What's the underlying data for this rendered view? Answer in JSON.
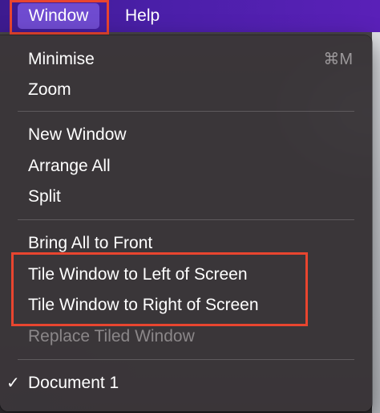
{
  "menubar": {
    "items": [
      {
        "label": "Window"
      },
      {
        "label": "Help"
      }
    ]
  },
  "menu": {
    "items": [
      {
        "label": "Minimise",
        "shortcut": "⌘M",
        "enabled": true
      },
      {
        "label": "Zoom",
        "enabled": true
      },
      {
        "label": "New Window",
        "enabled": true
      },
      {
        "label": "Arrange All",
        "enabled": true
      },
      {
        "label": "Split",
        "enabled": true
      },
      {
        "label": "Bring All to Front",
        "enabled": true
      },
      {
        "label": "Tile Window to Left of Screen",
        "enabled": true
      },
      {
        "label": "Tile Window to Right of Screen",
        "enabled": true
      },
      {
        "label": "Replace Tiled Window",
        "enabled": false
      },
      {
        "label": "Document 1",
        "checked": true,
        "check_glyph": "✓",
        "enabled": true
      }
    ]
  },
  "colors": {
    "menubar": "#4a1fa8",
    "active_menu_title": "#6f4bd0",
    "highlight_annotation": "#e8452f",
    "menu_background": "#3a3639",
    "disabled_text": "#8b8789"
  }
}
